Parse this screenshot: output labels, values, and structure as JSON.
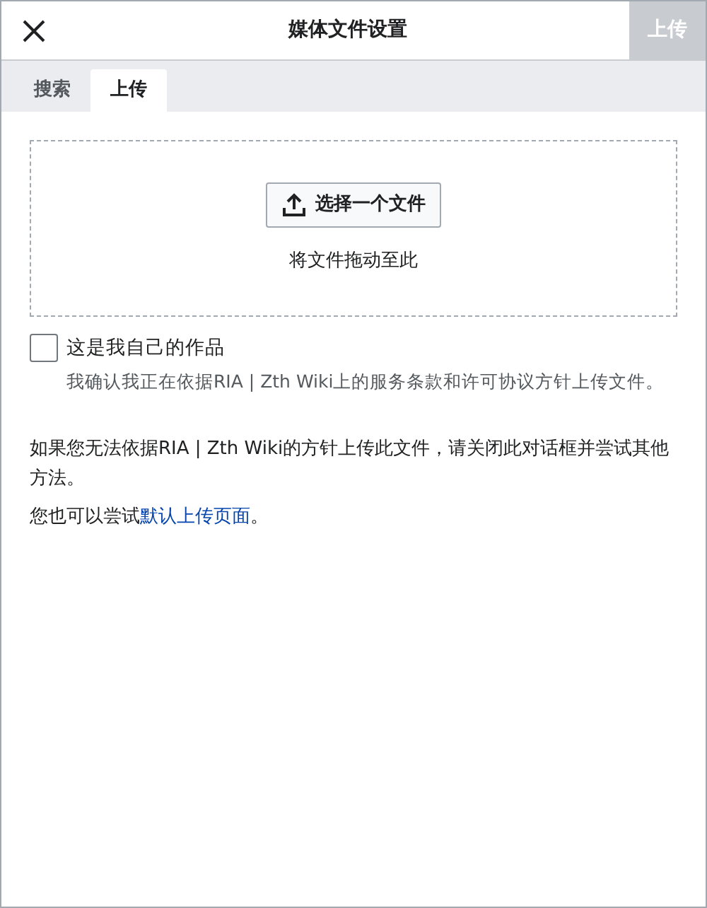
{
  "dialog": {
    "title": "媒体文件设置",
    "action_button": {
      "label": "上传",
      "disabled": true
    }
  },
  "tabs": [
    {
      "label": "搜索",
      "selected": false
    },
    {
      "label": "上传",
      "selected": true
    }
  ],
  "dropzone": {
    "button_label": "选择一个文件",
    "hint": "将文件拖动至此"
  },
  "own_work": {
    "label": "这是我自己的作品",
    "checked": false,
    "help": "我确认我正在依据RIA | Zth Wiki上的服务条款和许可协议方针上传文件。"
  },
  "notice": "如果您无法依据RIA | Zth Wiki的方针上传此文件，请关闭此对话框并尝试其他方法。",
  "alternative": {
    "prefix": "您也可以尝试",
    "link": "默认上传页面",
    "suffix": "。"
  }
}
